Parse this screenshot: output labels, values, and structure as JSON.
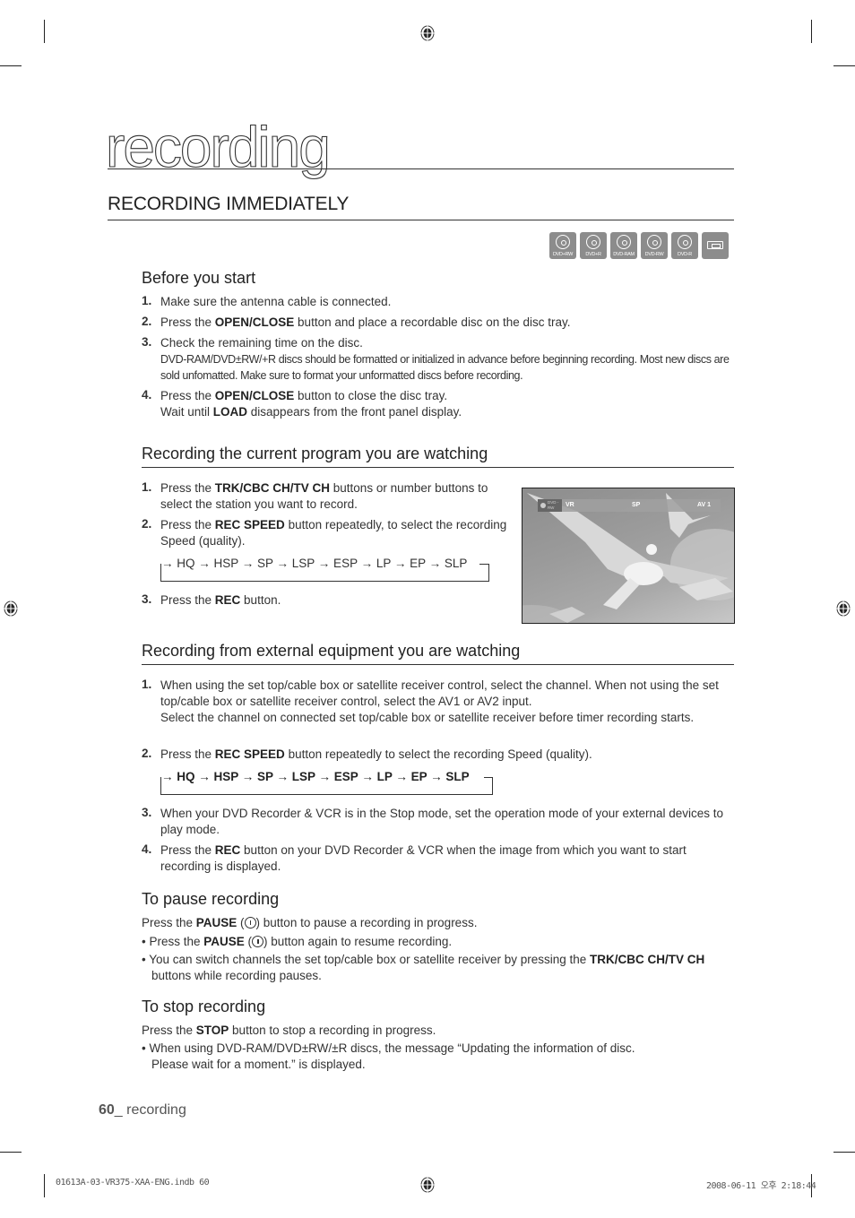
{
  "chapter": {
    "title": "recording"
  },
  "section": {
    "title": "RECORDING IMMEDIATELY"
  },
  "disc_icons": [
    {
      "icon": "dvd-disc-icon",
      "label": "DVD+RW"
    },
    {
      "icon": "dvd-disc-icon",
      "label": "DVD+R"
    },
    {
      "icon": "dvd-disc-icon",
      "label": "DVD-RAM"
    },
    {
      "icon": "dvd-disc-icon",
      "label": "DVD-RW"
    },
    {
      "icon": "dvd-disc-icon",
      "label": "DVD-R"
    },
    {
      "icon": "vhs-tape-icon",
      "label": ""
    }
  ],
  "before_you_start": {
    "heading": "Before you start",
    "steps": [
      {
        "num": "1.",
        "pre": "Make sure the antenna cable is connected.",
        "bold": "",
        "post": ""
      },
      {
        "num": "2.",
        "pre": "Press the ",
        "bold": "OPEN/CLOSE",
        "post": " button and place a recordable disc on the disc tray."
      },
      {
        "num": "3.",
        "pre": "Check the remaining time on the disc.",
        "bold": "",
        "post": "",
        "note": "DVD-RAM/DVD±RW/+R discs should be formatted or initialized in advance before beginning recording. Most new discs are sold unfomatted. Make sure to format your unformatted discs before recording."
      },
      {
        "num": "4.",
        "pre": "Press the ",
        "bold": "OPEN/CLOSE",
        "post": " button to close the disc tray.",
        "line2_pre": "Wait until ",
        "line2_bold": "LOAD",
        "line2_post": " disappears from the front panel display."
      }
    ]
  },
  "current_program": {
    "heading": "Recording the current program you are watching",
    "steps": [
      {
        "num": "1.",
        "pre": "Press the ",
        "bold": "TRK/CBC CH/TV CH",
        "post": " buttons or number buttons to select the station you want to record."
      },
      {
        "num": "2.",
        "pre": "Press the ",
        "bold": "REC SPEED",
        "post": " button repeatedly, to select the recording Speed (quality)."
      },
      {
        "num": "3.",
        "pre": "Press the ",
        "bold": "REC",
        "post": " button."
      }
    ],
    "speed_cycle": "→ HQ → HSP → SP → LSP → ESP → LP → EP → SLP",
    "screen_osd": {
      "disc": "DVD -RW",
      "mode": "VR",
      "speed": "SP",
      "input": "AV 1"
    }
  },
  "external_equipment": {
    "heading": "Recording from external equipment you are watching",
    "steps": [
      {
        "num": "1.",
        "text": "When using the set top/cable box or satellite receiver control, select the channel. When not using the set top/cable box or satellite receiver control, select the AV1 or AV2 input.",
        "text2": "Select the channel on connected set top/cable box or satellite receiver before timer recording starts."
      },
      {
        "num": "2.",
        "pre": "Press the ",
        "bold": "REC SPEED",
        "post": " button repeatedly to select the recording Speed (quality)."
      },
      {
        "num": "3.",
        "text": "When your DVD Recorder & VCR is in the Stop mode, set the operation mode of your external devices to play mode."
      },
      {
        "num": "4.",
        "pre": "Press the ",
        "bold": "REC",
        "post": " button on your DVD Recorder & VCR when the image from which you want to start recording is displayed."
      }
    ],
    "speed_cycle": "→ HQ → HSP → SP → LSP → ESP → LP → EP → SLP"
  },
  "pause": {
    "heading": "To pause recording",
    "intro_pre": "Press the ",
    "intro_bold": "PAUSE",
    "intro_post": ") button to pause a recording in progress.",
    "b1_pre": "• Press the ",
    "b1_bold": "PAUSE",
    "b1_post": ") button again to resume recording.",
    "b2_pre": "• You can switch channels the set top/cable box or satellite receiver by pressing the ",
    "b2_bold": "TRK/CBC CH/TV CH",
    "b2_post": " buttons while recording pauses."
  },
  "stop": {
    "heading": "To stop recording",
    "intro_pre": "Press the ",
    "intro_bold": "STOP",
    "intro_post": " button to stop a recording in progress.",
    "b1": "• When using DVD-RAM/DVD±RW/±R discs, the message “Updating the information of disc.",
    "b1_line2": "Please wait for a moment.” is displayed."
  },
  "footer": {
    "page_num": "60",
    "page_label": "_ recording"
  },
  "slug": {
    "file": "01613A-03-VR375-XAA-ENG.indb   60",
    "date": "2008-06-11   오후 2:18:44"
  }
}
